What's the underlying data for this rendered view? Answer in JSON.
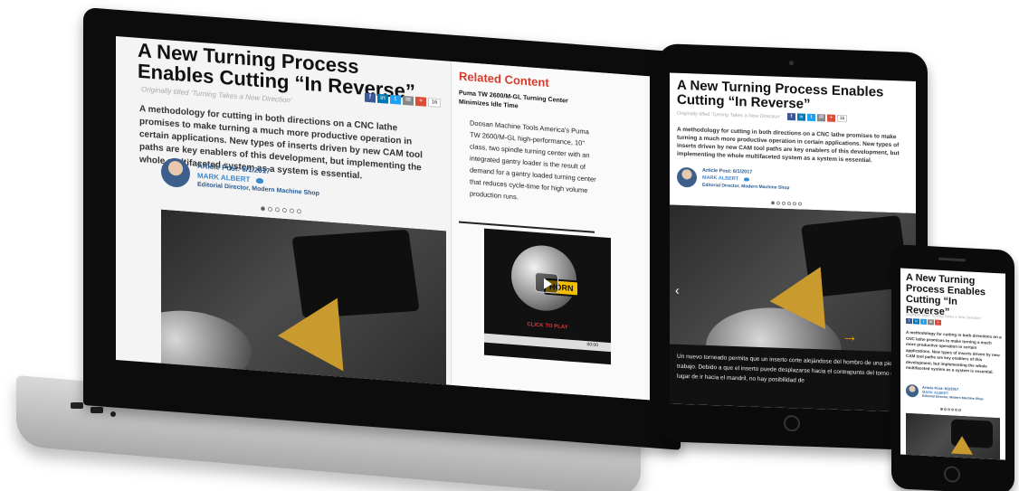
{
  "article": {
    "title": "A New Turning Process Enables Cutting “In Reverse”",
    "subtitle": "Originally titled ‘Turning Takes a New Direction’",
    "summary": "A methodology for cutting in both directions on a CNC lathe promises to make turning a much more productive operation in certain applications. New types of inserts driven by new CAM tool paths are key enablers of this development, but implementing the whole multifaceted system as a system is essential.",
    "post_date": "Article Post: 6/1/2017",
    "author": "MARK ALBERT",
    "author_role": "Editorial Director, Modern Machine Shop",
    "share_count": "16"
  },
  "share_icons": [
    {
      "name": "facebook-icon",
      "glyph": "f",
      "color": "#3b5998"
    },
    {
      "name": "linkedin-icon",
      "glyph": "in",
      "color": "#0077b5"
    },
    {
      "name": "twitter-icon",
      "glyph": "t",
      "color": "#1da1f2"
    },
    {
      "name": "email-icon",
      "glyph": "✉",
      "color": "#888888"
    },
    {
      "name": "googleplus-icon",
      "glyph": "+",
      "color": "#dd4b39"
    }
  ],
  "related": {
    "heading": "Related Content",
    "item_title": "Puma TW 2600/M-GL Turning Center Minimizes Idle Time",
    "body": "Doosan Machine Tools America's Puma TW 2600/M-GL high-performance, 10\" class, two spindle turning center with an integrated gantry loader is the result of demand for a gantry loaded turning center that reduces cycle-time for high volume production runs.",
    "video_badge": "HORN",
    "video_cta": "CLICK TO PLAY",
    "video_time": "00:00"
  },
  "tablet": {
    "caption": "Un nuevo torneado permita que un inserto corte alejándose del hombro de una pieza de trabajo. Debido a que el inserto puede desplazarse hacia el contrapunto del torno en lugar de ir hacia el mandril, no hay posibilidad de"
  },
  "colors": {
    "accent_red": "#d63a2b",
    "link_blue": "#3b8ad6",
    "insert_gold": "#c99a2e"
  }
}
